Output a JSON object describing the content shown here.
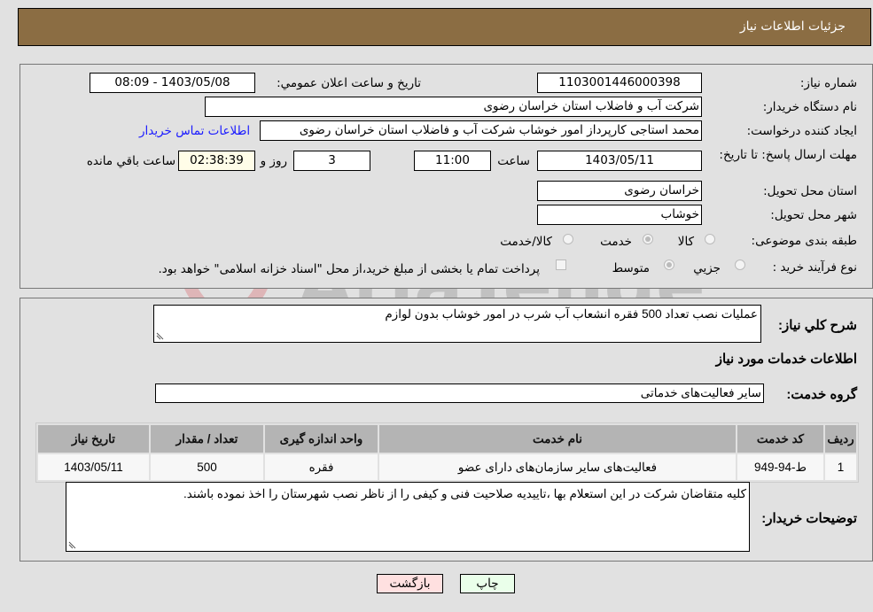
{
  "header": {
    "title": "جزئیات اطلاعات نیاز"
  },
  "form": {
    "need_number": {
      "label": "شماره نیاز:",
      "value": "1103001446000398"
    },
    "announce_datetime": {
      "label": "تاریخ و ساعت اعلان عمومي:",
      "value": "1403/05/08 - 08:09"
    },
    "buyer_org": {
      "label": "نام دستگاه خريدار:",
      "value": "شرکت آب و فاضلاب استان خراسان رضوی"
    },
    "creator": {
      "label": "ایجاد کننده درخواست:",
      "value": "محمد استاجی کارپرداز امور خوشاب  شرکت آب و فاضلاب استان خراسان رضوی"
    },
    "buyer_contact_link": "اطلاعات تماس خریدار",
    "deadline": {
      "label": "مهلت ارسال پاسخ: تا تاریخ:",
      "date": "1403/05/11",
      "time_label": "ساعت",
      "time": "11:00",
      "days": "3",
      "days_label": "روز و",
      "remaining": "02:38:39",
      "remaining_label": "ساعت باقي مانده"
    },
    "delivery_province": {
      "label": "استان محل تحویل:",
      "value": "خراسان رضوی"
    },
    "delivery_city": {
      "label": "شهر محل تحویل:",
      "value": "خوشاب"
    },
    "category": {
      "label": "طبقه بندی موضوعی:",
      "options": [
        "کالا",
        "خدمت",
        "کالا/خدمت"
      ],
      "selected": "خدمت"
    },
    "purchase_type": {
      "label": "نوع فرآیند خرید :",
      "options": [
        "جزيي",
        "متوسط"
      ],
      "selected": "متوسط",
      "treasury_note": "پرداخت تمام یا بخشی از مبلغ خرید،از محل \"اسناد خزانه اسلامی\" خواهد بود."
    }
  },
  "details": {
    "summary_label": "شرح كلي نياز:",
    "summary": "عملیات نصب تعداد 500 فقره  انشعاب آب شرب  در امور خوشاب بدون لوازم",
    "services_title": "اطلاعات خدمات مورد نیاز",
    "service_group_label": "گروه خدمت:",
    "service_group": "سایر فعالیت‌های خدماتی",
    "table": {
      "headers": [
        "ردیف",
        "کد خدمت",
        "نام خدمت",
        "واحد اندازه گیری",
        "تعداد / مقدار",
        "تاریخ نیاز"
      ],
      "rows": [
        [
          "1",
          "ط-94-949",
          "فعالیت‌های سایر سازمان‌های دارای عضو",
          "فقره",
          "500",
          "1403/05/11"
        ]
      ]
    },
    "buyer_notes_label": "توضیحات خریدار:",
    "buyer_notes": "کلیه متقاضان  شرکت در این استعلام بها  ،تاییدیه صلاحیت فنی و  کیفی  را از  ناظر نصب شهرستان را اخذ نموده باشند."
  },
  "buttons": {
    "print": "چاپ",
    "back": "بازگشت"
  },
  "watermark": "AriaTender.neT",
  "colors": {
    "header_bg": "#8b6d43",
    "link": "#1a1aff",
    "back_btn": "#ffe0e0",
    "print_btn": "#eaffea"
  }
}
